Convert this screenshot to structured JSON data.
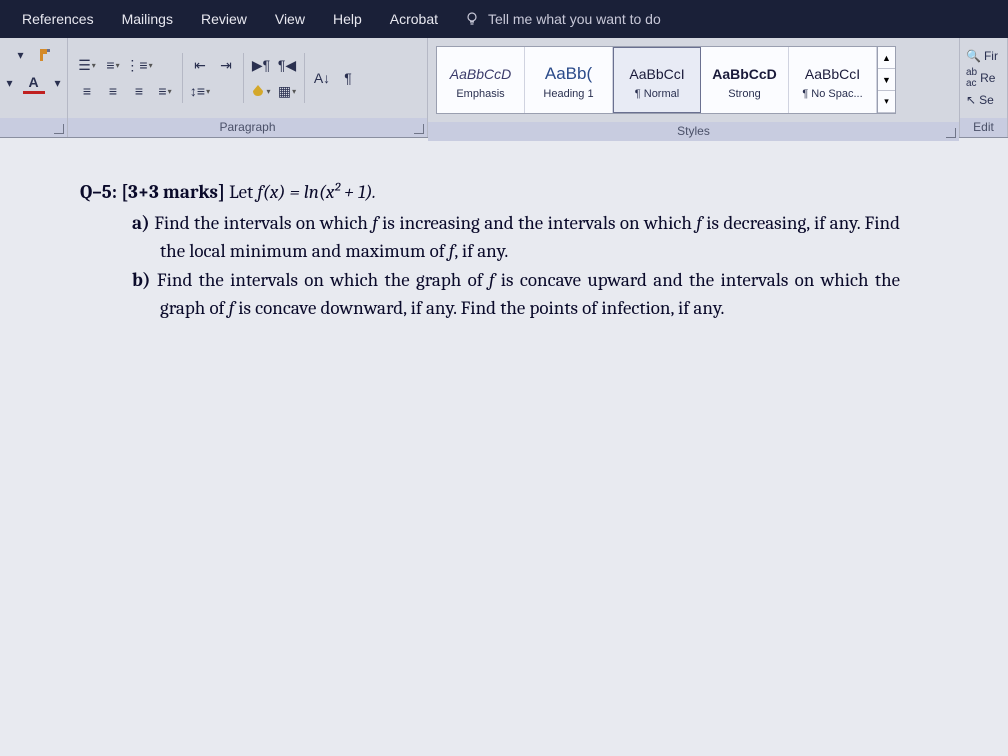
{
  "tabs": {
    "references": "References",
    "mailings": "Mailings",
    "review": "Review",
    "view": "View",
    "help": "Help",
    "acrobat": "Acrobat",
    "tellme": "Tell me what you want to do"
  },
  "groups": {
    "paragraph": "Paragraph",
    "styles": "Styles",
    "editing": "Edit"
  },
  "styles": [
    {
      "preview": "AaBbCcD",
      "name": "Emphasis",
      "cls": "italic"
    },
    {
      "preview": "AaBb(",
      "name": "Heading 1",
      "cls": "h1"
    },
    {
      "preview": "AaBbCcI",
      "name": "¶ Normal",
      "cls": "",
      "selected": true
    },
    {
      "preview": "AaBbCcD",
      "name": "Strong",
      "cls": ""
    },
    {
      "preview": "AaBbCcI",
      "name": "¶ No Spac...",
      "cls": ""
    }
  ],
  "editing": {
    "find": "Fir",
    "replace": "Re",
    "select": "Se"
  },
  "doc": {
    "q_prefix": "Q–5: ",
    "marks": "[3+3 marks]",
    "lead": " Let ",
    "fx": "f(x) = ln(x² + 1).",
    "a_label": "a) ",
    "a_text1": "Find the intervals on which ",
    "a_f1": "f",
    "a_text2": " is increasing and the intervals on which ",
    "a_f2": "f",
    "a_text3": " is decreasing, if any. Find the local minimum and maximum of ",
    "a_f3": "f",
    "a_text4": ", if any.",
    "b_label": "b) ",
    "b_text1": "Find the intervals on which the graph of ",
    "b_f1": "f",
    "b_text2": " is concave upward and the intervals on which the graph of ",
    "b_f2": "f",
    "b_text3": " is concave downward, if any. Find the points of infection, if any."
  }
}
